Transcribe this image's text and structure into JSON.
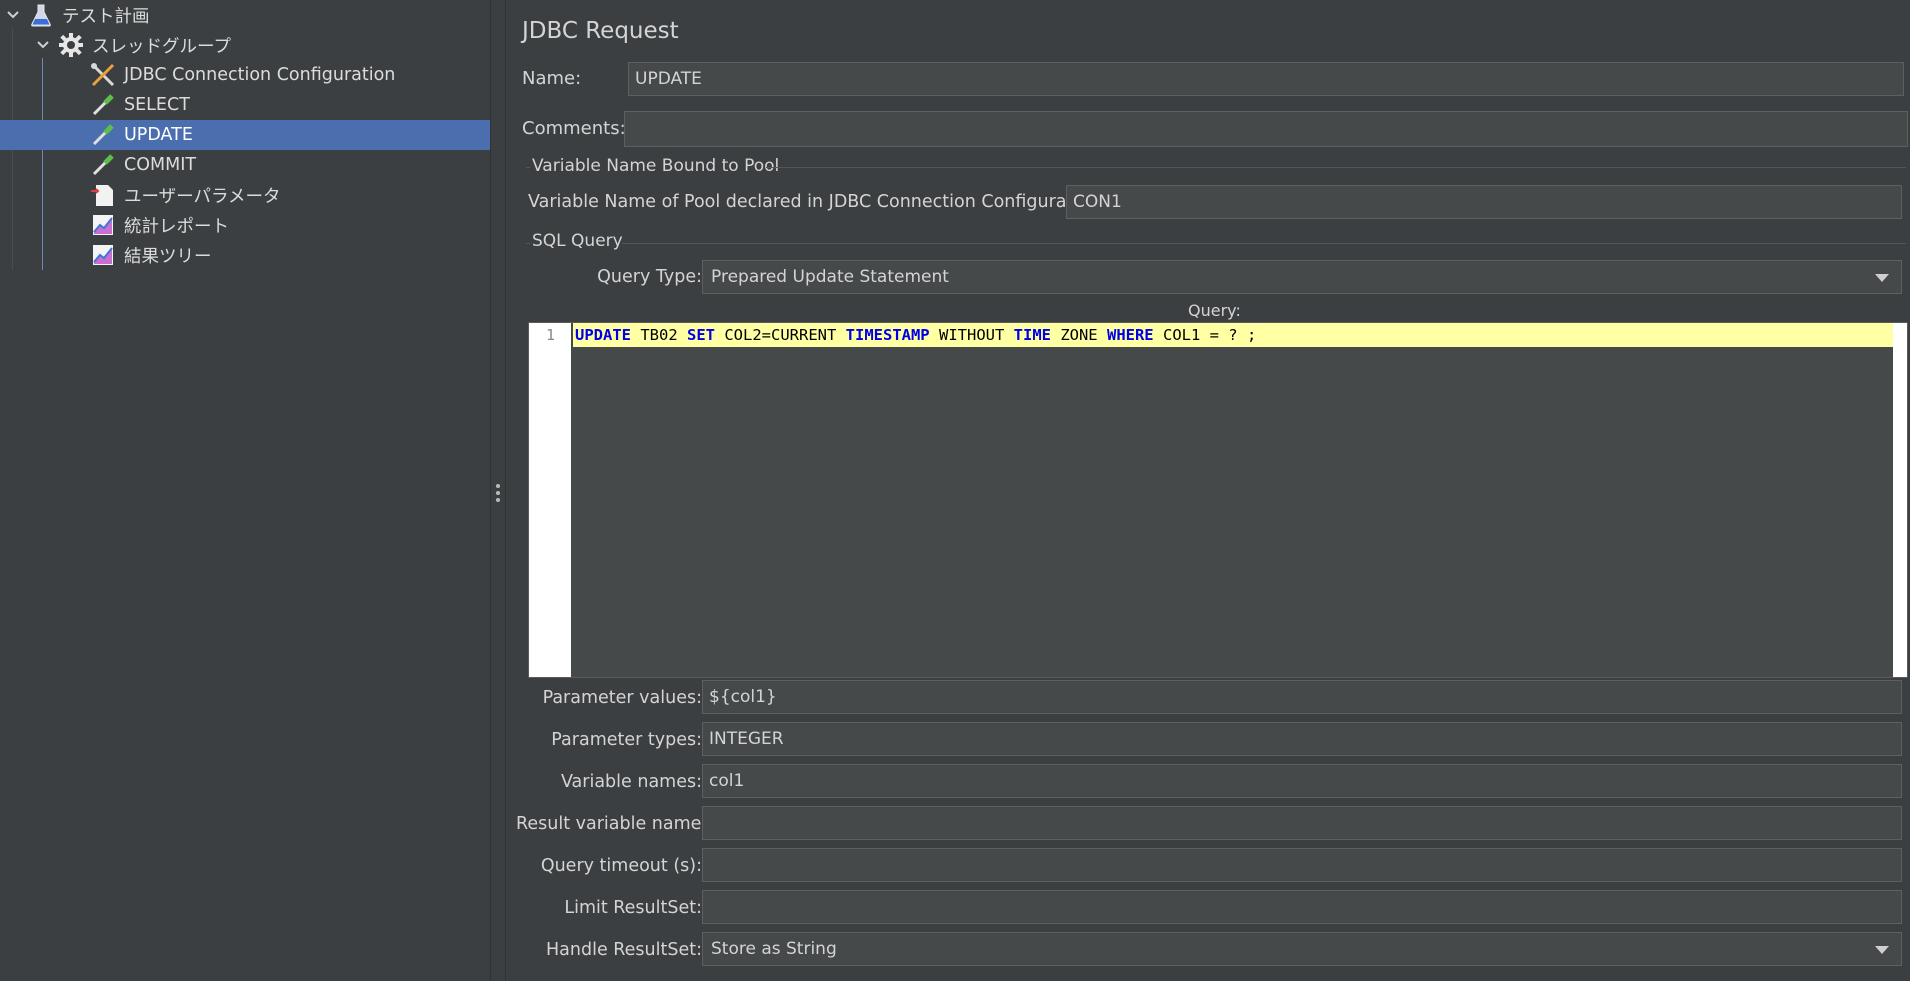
{
  "tree": {
    "items": [
      {
        "label": "テスト計画",
        "icon": "flask-icon"
      },
      {
        "label": "スレッドグループ",
        "icon": "gear-icon"
      },
      {
        "label": "JDBC Connection Configuration",
        "icon": "tools-icon"
      },
      {
        "label": "SELECT",
        "icon": "pipette-icon"
      },
      {
        "label": "UPDATE",
        "icon": "pipette-icon",
        "selected": true
      },
      {
        "label": "COMMIT",
        "icon": "pipette-icon"
      },
      {
        "label": "ユーザーパラメータ",
        "icon": "document-icon"
      },
      {
        "label": "統計レポート",
        "icon": "chart-icon"
      },
      {
        "label": "結果ツリー",
        "icon": "chart-icon"
      }
    ]
  },
  "panel": {
    "title": "JDBC Request",
    "name_label": "Name:",
    "name_value": "UPDATE",
    "comments_label": "Comments:",
    "comments_value": "",
    "pool_section": "Variable Name Bound to Pool",
    "pool_label": "Variable Name of Pool declared in JDBC Connection Configuration:",
    "pool_value": "CON1",
    "sql_section": "SQL Query",
    "query_type_label": "Query Type:",
    "query_type_value": "Prepared Update Statement",
    "query_label": "Query:",
    "query_line_number": "1",
    "query_tokens": {
      "t1": "UPDATE",
      "t2": " TB02 ",
      "t3": "SET",
      "t4": " COL2=CURRENT ",
      "t5": "TIMESTAMP",
      "t6": " WITHOUT ",
      "t7": "TIME",
      "t8": " ZONE ",
      "t9": "WHERE",
      "t10": " COL1 = ? ;"
    },
    "param_values_label": "Parameter values:",
    "param_values": "${col1}",
    "param_types_label": "Parameter types:",
    "param_types": "INTEGER",
    "var_names_label": "Variable names:",
    "var_names": "col1",
    "result_var_label": "Result variable name:",
    "result_var": "",
    "timeout_label": "Query timeout (s):",
    "timeout": "",
    "limit_label": "Limit ResultSet:",
    "limit": "",
    "handle_label": "Handle ResultSet:",
    "handle_value": "Store as String"
  },
  "colors": {
    "background": "#3c3f41",
    "selection": "#4b6eaf",
    "field": "#45494a",
    "keyword": "#0000e6",
    "current_line": "#ffffa4"
  }
}
